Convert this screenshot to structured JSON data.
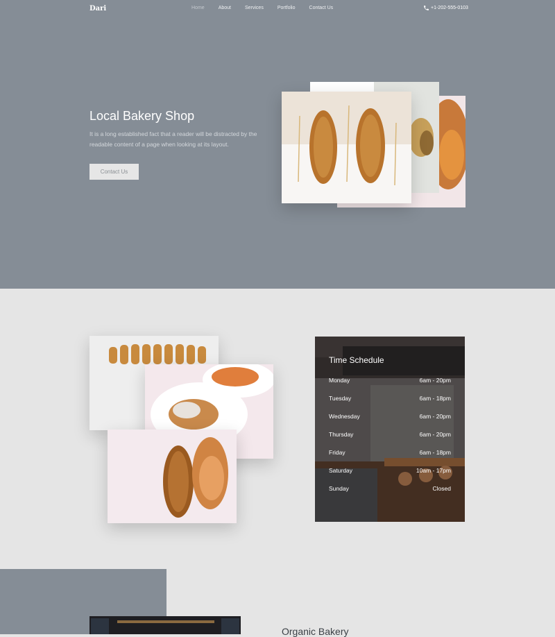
{
  "nav": {
    "brand": "Dari",
    "links": [
      {
        "label": "Home",
        "active": true
      },
      {
        "label": "About",
        "active": false
      },
      {
        "label": "Services",
        "active": false
      },
      {
        "label": "Portfolio",
        "active": false
      },
      {
        "label": "Contact Us",
        "active": false
      }
    ],
    "phone": "+1-202-555-0103"
  },
  "hero": {
    "title": "Local Bakery Shop",
    "description": "It is a long established fact that a reader will be distracted by the readable content of a page when looking at its layout.",
    "button": "Contact Us"
  },
  "schedule": {
    "title": "Time Schedule",
    "rows": [
      {
        "day": "Monday",
        "hours": "6am - 20pm"
      },
      {
        "day": "Tuesday",
        "hours": "6am - 18pm"
      },
      {
        "day": "Wednesday",
        "hours": "6am - 20pm"
      },
      {
        "day": "Thursday",
        "hours": "6am - 20pm"
      },
      {
        "day": "Friday",
        "hours": "6am - 18pm"
      },
      {
        "day": "Saturday",
        "hours": "10am - 17pm"
      },
      {
        "day": "Sunday",
        "hours": "Closed"
      }
    ]
  },
  "organic": {
    "title": "Organic Bakery"
  },
  "colors": {
    "hero_bg": "#858d96",
    "page_bg": "#e5e5e5",
    "accent_text": "#ffffff"
  }
}
